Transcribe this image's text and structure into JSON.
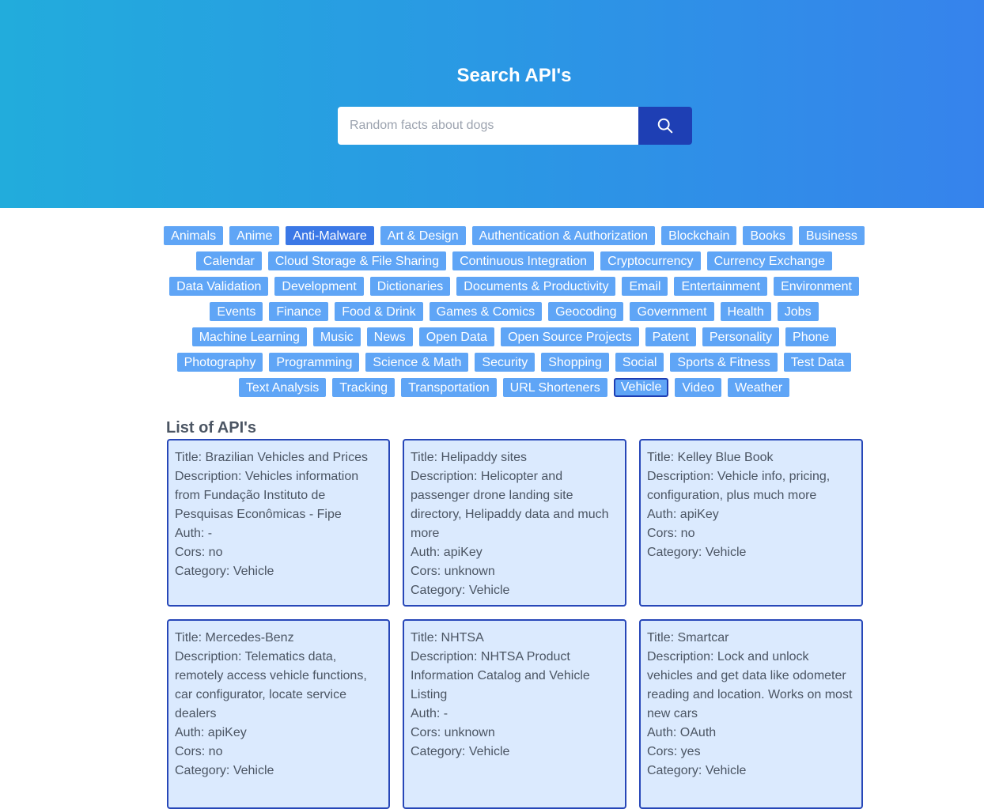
{
  "hero": {
    "title": "Search API's",
    "search_placeholder": "Random facts about dogs",
    "search_icon": "search-icon"
  },
  "categories": [
    {
      "label": "Animals"
    },
    {
      "label": "Anime"
    },
    {
      "label": "Anti-Malware",
      "active": true
    },
    {
      "label": "Art & Design"
    },
    {
      "label": "Authentication & Authorization"
    },
    {
      "label": "Blockchain"
    },
    {
      "label": "Books"
    },
    {
      "label": "Business"
    },
    {
      "label": "Calendar"
    },
    {
      "label": "Cloud Storage & File Sharing"
    },
    {
      "label": "Continuous Integration"
    },
    {
      "label": "Cryptocurrency"
    },
    {
      "label": "Currency Exchange"
    },
    {
      "label": "Data Validation"
    },
    {
      "label": "Development"
    },
    {
      "label": "Dictionaries"
    },
    {
      "label": "Documents & Productivity"
    },
    {
      "label": "Email"
    },
    {
      "label": "Entertainment"
    },
    {
      "label": "Environment"
    },
    {
      "label": "Events"
    },
    {
      "label": "Finance"
    },
    {
      "label": "Food & Drink"
    },
    {
      "label": "Games & Comics"
    },
    {
      "label": "Geocoding"
    },
    {
      "label": "Government"
    },
    {
      "label": "Health"
    },
    {
      "label": "Jobs"
    },
    {
      "label": "Machine Learning"
    },
    {
      "label": "Music"
    },
    {
      "label": "News"
    },
    {
      "label": "Open Data"
    },
    {
      "label": "Open Source Projects"
    },
    {
      "label": "Patent"
    },
    {
      "label": "Personality"
    },
    {
      "label": "Phone"
    },
    {
      "label": "Photography"
    },
    {
      "label": "Programming"
    },
    {
      "label": "Science & Math"
    },
    {
      "label": "Security"
    },
    {
      "label": "Shopping"
    },
    {
      "label": "Social"
    },
    {
      "label": "Sports & Fitness"
    },
    {
      "label": "Test Data"
    },
    {
      "label": "Text Analysis"
    },
    {
      "label": "Tracking"
    },
    {
      "label": "Transportation"
    },
    {
      "label": "URL Shorteners"
    },
    {
      "label": "Vehicle",
      "selected": true
    },
    {
      "label": "Video"
    },
    {
      "label": "Weather"
    }
  ],
  "list_title": "List of API's",
  "apis": [
    {
      "title": "Title: Brazilian Vehicles and Prices",
      "description": "Description: Vehicles information from Fundação Instituto de Pesquisas Econômicas - Fipe",
      "auth": "Auth: -",
      "cors": "Cors: no",
      "category": "Category: Vehicle"
    },
    {
      "title": "Title: Helipaddy sites",
      "description": "Description: Helicopter and passenger drone landing site directory, Helipaddy data and much more",
      "auth": "Auth: apiKey",
      "cors": "Cors: unknown",
      "category": "Category: Vehicle"
    },
    {
      "title": "Title: Kelley Blue Book",
      "description": "Description: Vehicle info, pricing, configuration, plus much more",
      "auth": "Auth: apiKey",
      "cors": "Cors: no",
      "category": "Category: Vehicle"
    },
    {
      "title": "Title: Mercedes-Benz",
      "description": "Description: Telematics data, remotely access vehicle functions, car configurator, locate service dealers",
      "auth": "Auth: apiKey",
      "cors": "Cors: no",
      "category": "Category: Vehicle"
    },
    {
      "title": "Title: NHTSA",
      "description": "Description: NHTSA Product Information Catalog and Vehicle Listing",
      "auth": "Auth: -",
      "cors": "Cors: unknown",
      "category": "Category: Vehicle"
    },
    {
      "title": "Title: Smartcar",
      "description": "Description: Lock and unlock vehicles and get data like odometer reading and location. Works on most new cars",
      "auth": "Auth: OAuth",
      "cors": "Cors: yes",
      "category": "Category: Vehicle"
    }
  ]
}
